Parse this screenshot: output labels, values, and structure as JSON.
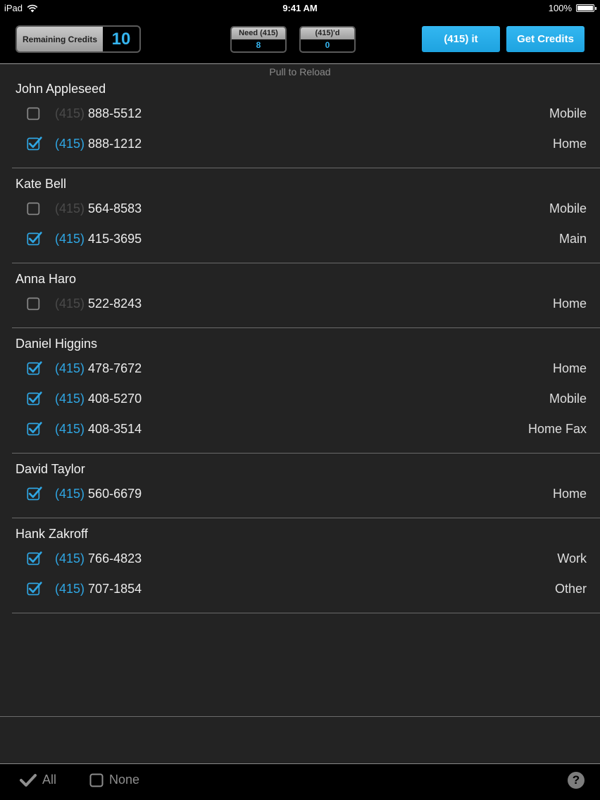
{
  "status": {
    "device": "iPad",
    "time": "9:41 AM",
    "battery": "100%"
  },
  "toolbar": {
    "credits_label": "Remaining Credits",
    "credits_value": "10",
    "need_label": "Need (415)",
    "need_value": "8",
    "done_label": "(415)'d",
    "done_value": "0",
    "primary_button": "(415) it",
    "get_credits_button": "Get Credits"
  },
  "pull_text": "Pull to Reload",
  "accent_color": "#2fa6e3",
  "contacts": [
    {
      "name": "John Appleseed",
      "phones": [
        {
          "checked": false,
          "area": "(415)",
          "number": "888-5512",
          "type": "Mobile"
        },
        {
          "checked": true,
          "area": "(415)",
          "number": "888-1212",
          "type": "Home"
        }
      ]
    },
    {
      "name": "Kate Bell",
      "phones": [
        {
          "checked": false,
          "area": "(415)",
          "number": "564-8583",
          "type": "Mobile"
        },
        {
          "checked": true,
          "area": "(415)",
          "number": "415-3695",
          "type": "Main"
        }
      ]
    },
    {
      "name": "Anna Haro",
      "phones": [
        {
          "checked": false,
          "area": "(415)",
          "number": "522-8243",
          "type": "Home"
        }
      ]
    },
    {
      "name": "Daniel Higgins",
      "phones": [
        {
          "checked": true,
          "area": "(415)",
          "number": "478-7672",
          "type": "Home"
        },
        {
          "checked": true,
          "area": "(415)",
          "number": "408-5270",
          "type": "Mobile"
        },
        {
          "checked": true,
          "area": "(415)",
          "number": "408-3514",
          "type": "Home Fax"
        }
      ]
    },
    {
      "name": "David Taylor",
      "phones": [
        {
          "checked": true,
          "area": "(415)",
          "number": "560-6679",
          "type": "Home"
        }
      ]
    },
    {
      "name": "Hank Zakroff",
      "phones": [
        {
          "checked": true,
          "area": "(415)",
          "number": "766-4823",
          "type": "Work"
        },
        {
          "checked": true,
          "area": "(415)",
          "number": "707-1854",
          "type": "Other"
        }
      ]
    }
  ],
  "bottom": {
    "all_label": "All",
    "none_label": "None",
    "help_label": "?"
  },
  "icons": {
    "wifi": "wifi-icon",
    "battery": "battery-icon",
    "check": "checkmark-icon",
    "checkbox": "checkbox-icon",
    "help": "help-icon"
  }
}
